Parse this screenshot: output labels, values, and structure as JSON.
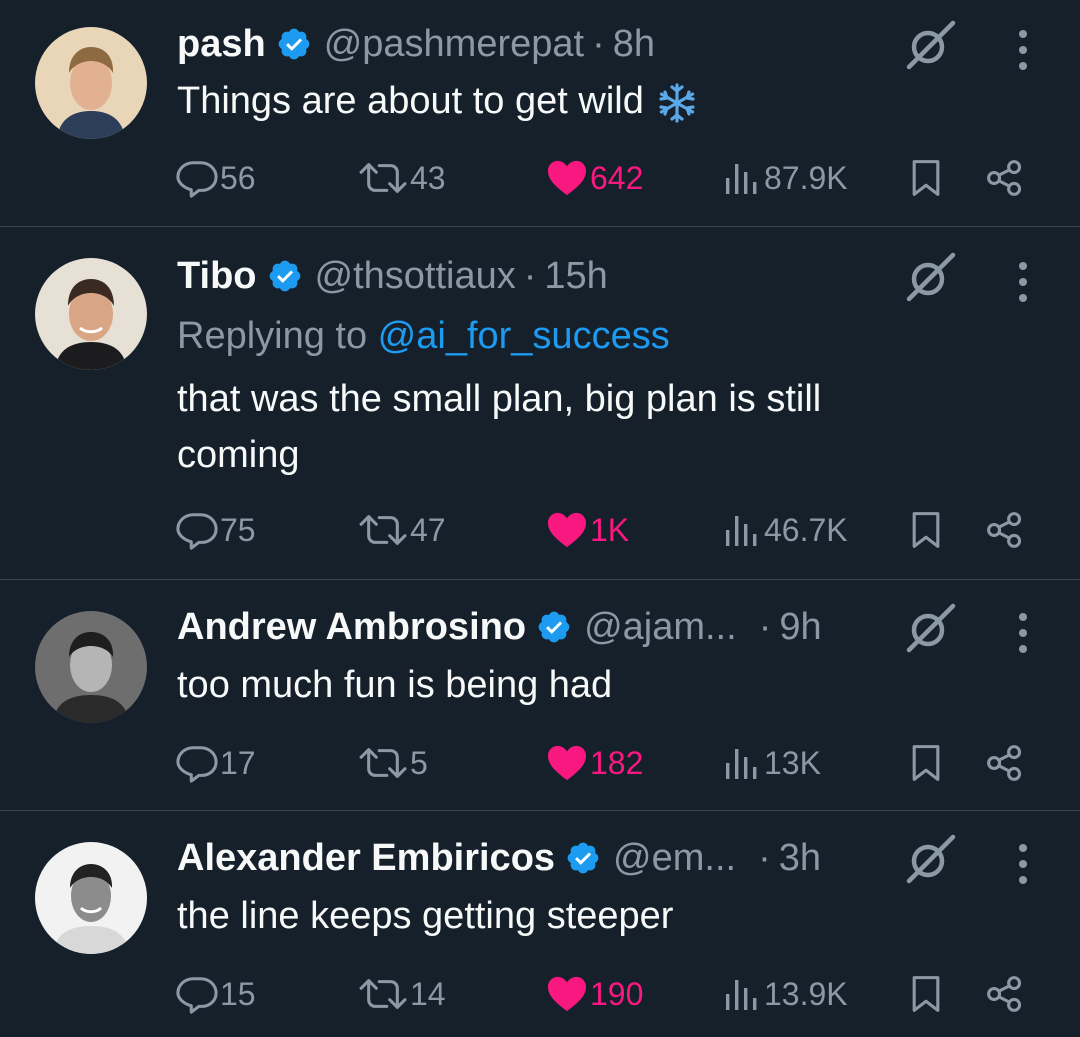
{
  "colors": {
    "background": "#15202b",
    "text": "#f7f9f9",
    "muted": "#8b98a5",
    "accent": "#1d9bf0",
    "like": "#f91880",
    "divider": "#38444d"
  },
  "tweets": [
    {
      "name": "pash",
      "handle": "@pashmerepat",
      "dot": "·",
      "time": "8h",
      "text": "Things are about to get wild",
      "emoji": "snowflake-icon",
      "replies": "56",
      "reposts": "43",
      "likes": "642",
      "views": "87.9K"
    },
    {
      "name": "Tibo",
      "handle": "@thsottiaux",
      "dot": "·",
      "time": "15h",
      "replying_prefix": "Replying to ",
      "replying_to": "@ai_for_success",
      "text": "that was the small plan, big plan is still coming",
      "replies": "75",
      "reposts": "47",
      "likes": "1K",
      "views": "46.7K"
    },
    {
      "name": "Andrew Ambrosino",
      "handle": "@ajam...",
      "dot": "·",
      "time": "9h",
      "text": "too much fun is being had",
      "replies": "17",
      "reposts": "5",
      "likes": "182",
      "views": "13K"
    },
    {
      "name": "Alexander Embiricos",
      "handle": "@em...",
      "dot": "·",
      "time": "3h",
      "text": "the line keeps getting steeper",
      "replies": "15",
      "reposts": "14",
      "likes": "190",
      "views": "13.9K"
    }
  ]
}
